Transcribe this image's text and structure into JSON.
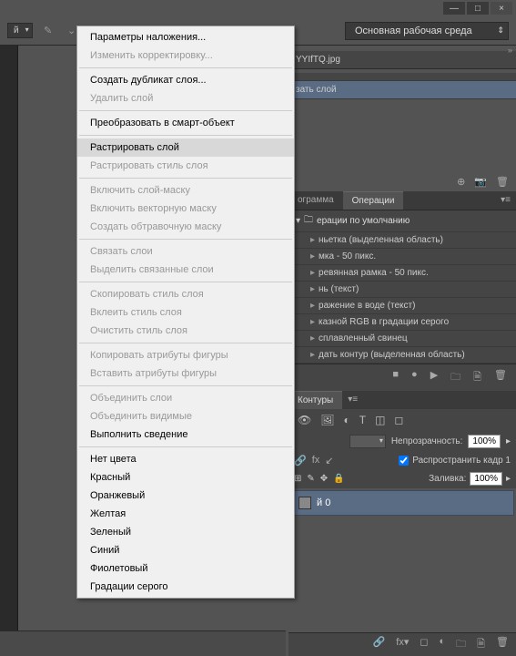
{
  "window": {
    "min": "—",
    "max": "□",
    "close": "×"
  },
  "toolbar": {
    "left_dd": "й",
    "workspace": "Основная рабочая среда"
  },
  "contextMenu": {
    "groups": [
      [
        {
          "label": "Параметры наложения...",
          "disabled": false
        },
        {
          "label": "Изменить корректировку...",
          "disabled": true
        }
      ],
      [
        {
          "label": "Создать дубликат слоя...",
          "disabled": false
        },
        {
          "label": "Удалить слой",
          "disabled": true
        }
      ],
      [
        {
          "label": "Преобразовать в смарт-объект",
          "disabled": false
        }
      ],
      [
        {
          "label": "Растрировать слой",
          "disabled": false,
          "hover": true
        },
        {
          "label": "Растрировать стиль слоя",
          "disabled": true
        }
      ],
      [
        {
          "label": "Включить слой-маску",
          "disabled": true
        },
        {
          "label": "Включить векторную маску",
          "disabled": true
        },
        {
          "label": "Создать обтравочную маску",
          "disabled": true
        }
      ],
      [
        {
          "label": "Связать слои",
          "disabled": true
        },
        {
          "label": "Выделить связанные слои",
          "disabled": true
        }
      ],
      [
        {
          "label": "Скопировать стиль слоя",
          "disabled": true
        },
        {
          "label": "Вклеить стиль слоя",
          "disabled": true
        },
        {
          "label": "Очистить стиль слоя",
          "disabled": true
        }
      ],
      [
        {
          "label": "Копировать атрибуты фигуры",
          "disabled": true
        },
        {
          "label": "Вставить атрибуты фигуры",
          "disabled": true
        }
      ],
      [
        {
          "label": "Объединить слои",
          "disabled": true
        },
        {
          "label": "Объединить видимые",
          "disabled": true
        },
        {
          "label": "Выполнить сведение",
          "disabled": false
        }
      ],
      [
        {
          "label": "Нет цвета",
          "disabled": false
        },
        {
          "label": "Красный",
          "disabled": false
        },
        {
          "label": "Оранжевый",
          "disabled": false
        },
        {
          "label": "Желтая",
          "disabled": false
        },
        {
          "label": "Зеленый",
          "disabled": false
        },
        {
          "label": "Синий",
          "disabled": false
        },
        {
          "label": "Фиолетовый",
          "disabled": false
        },
        {
          "label": "Градации серого",
          "disabled": false
        }
      ]
    ]
  },
  "doc": {
    "filename": "YYIfTQ.jpg"
  },
  "innerPanel": {
    "row1": "",
    "row2": "зать слой"
  },
  "tabs1": {
    "t1": "ограмма",
    "t2": "Операции"
  },
  "ops": {
    "folder": "ерации по умолчанию",
    "rows": [
      "ньетка (выделенная область)",
      "мка - 50 пикс.",
      "ревянная рамка - 50 пикс.",
      "нь (текст)",
      "ражение в воде (текст)",
      "казной RGB в градации серого",
      "сплавленный свинец",
      "дать контур (выделенная область)"
    ]
  },
  "tabs2": {
    "t1": "Контуры"
  },
  "layerPanel": {
    "opacity_label": "Непрозрачность:",
    "opacity_val": "100%",
    "propagate": "Распространить кадр 1",
    "fill_label": "Заливка:",
    "fill_val": "100%",
    "layer_name": "й 0"
  }
}
